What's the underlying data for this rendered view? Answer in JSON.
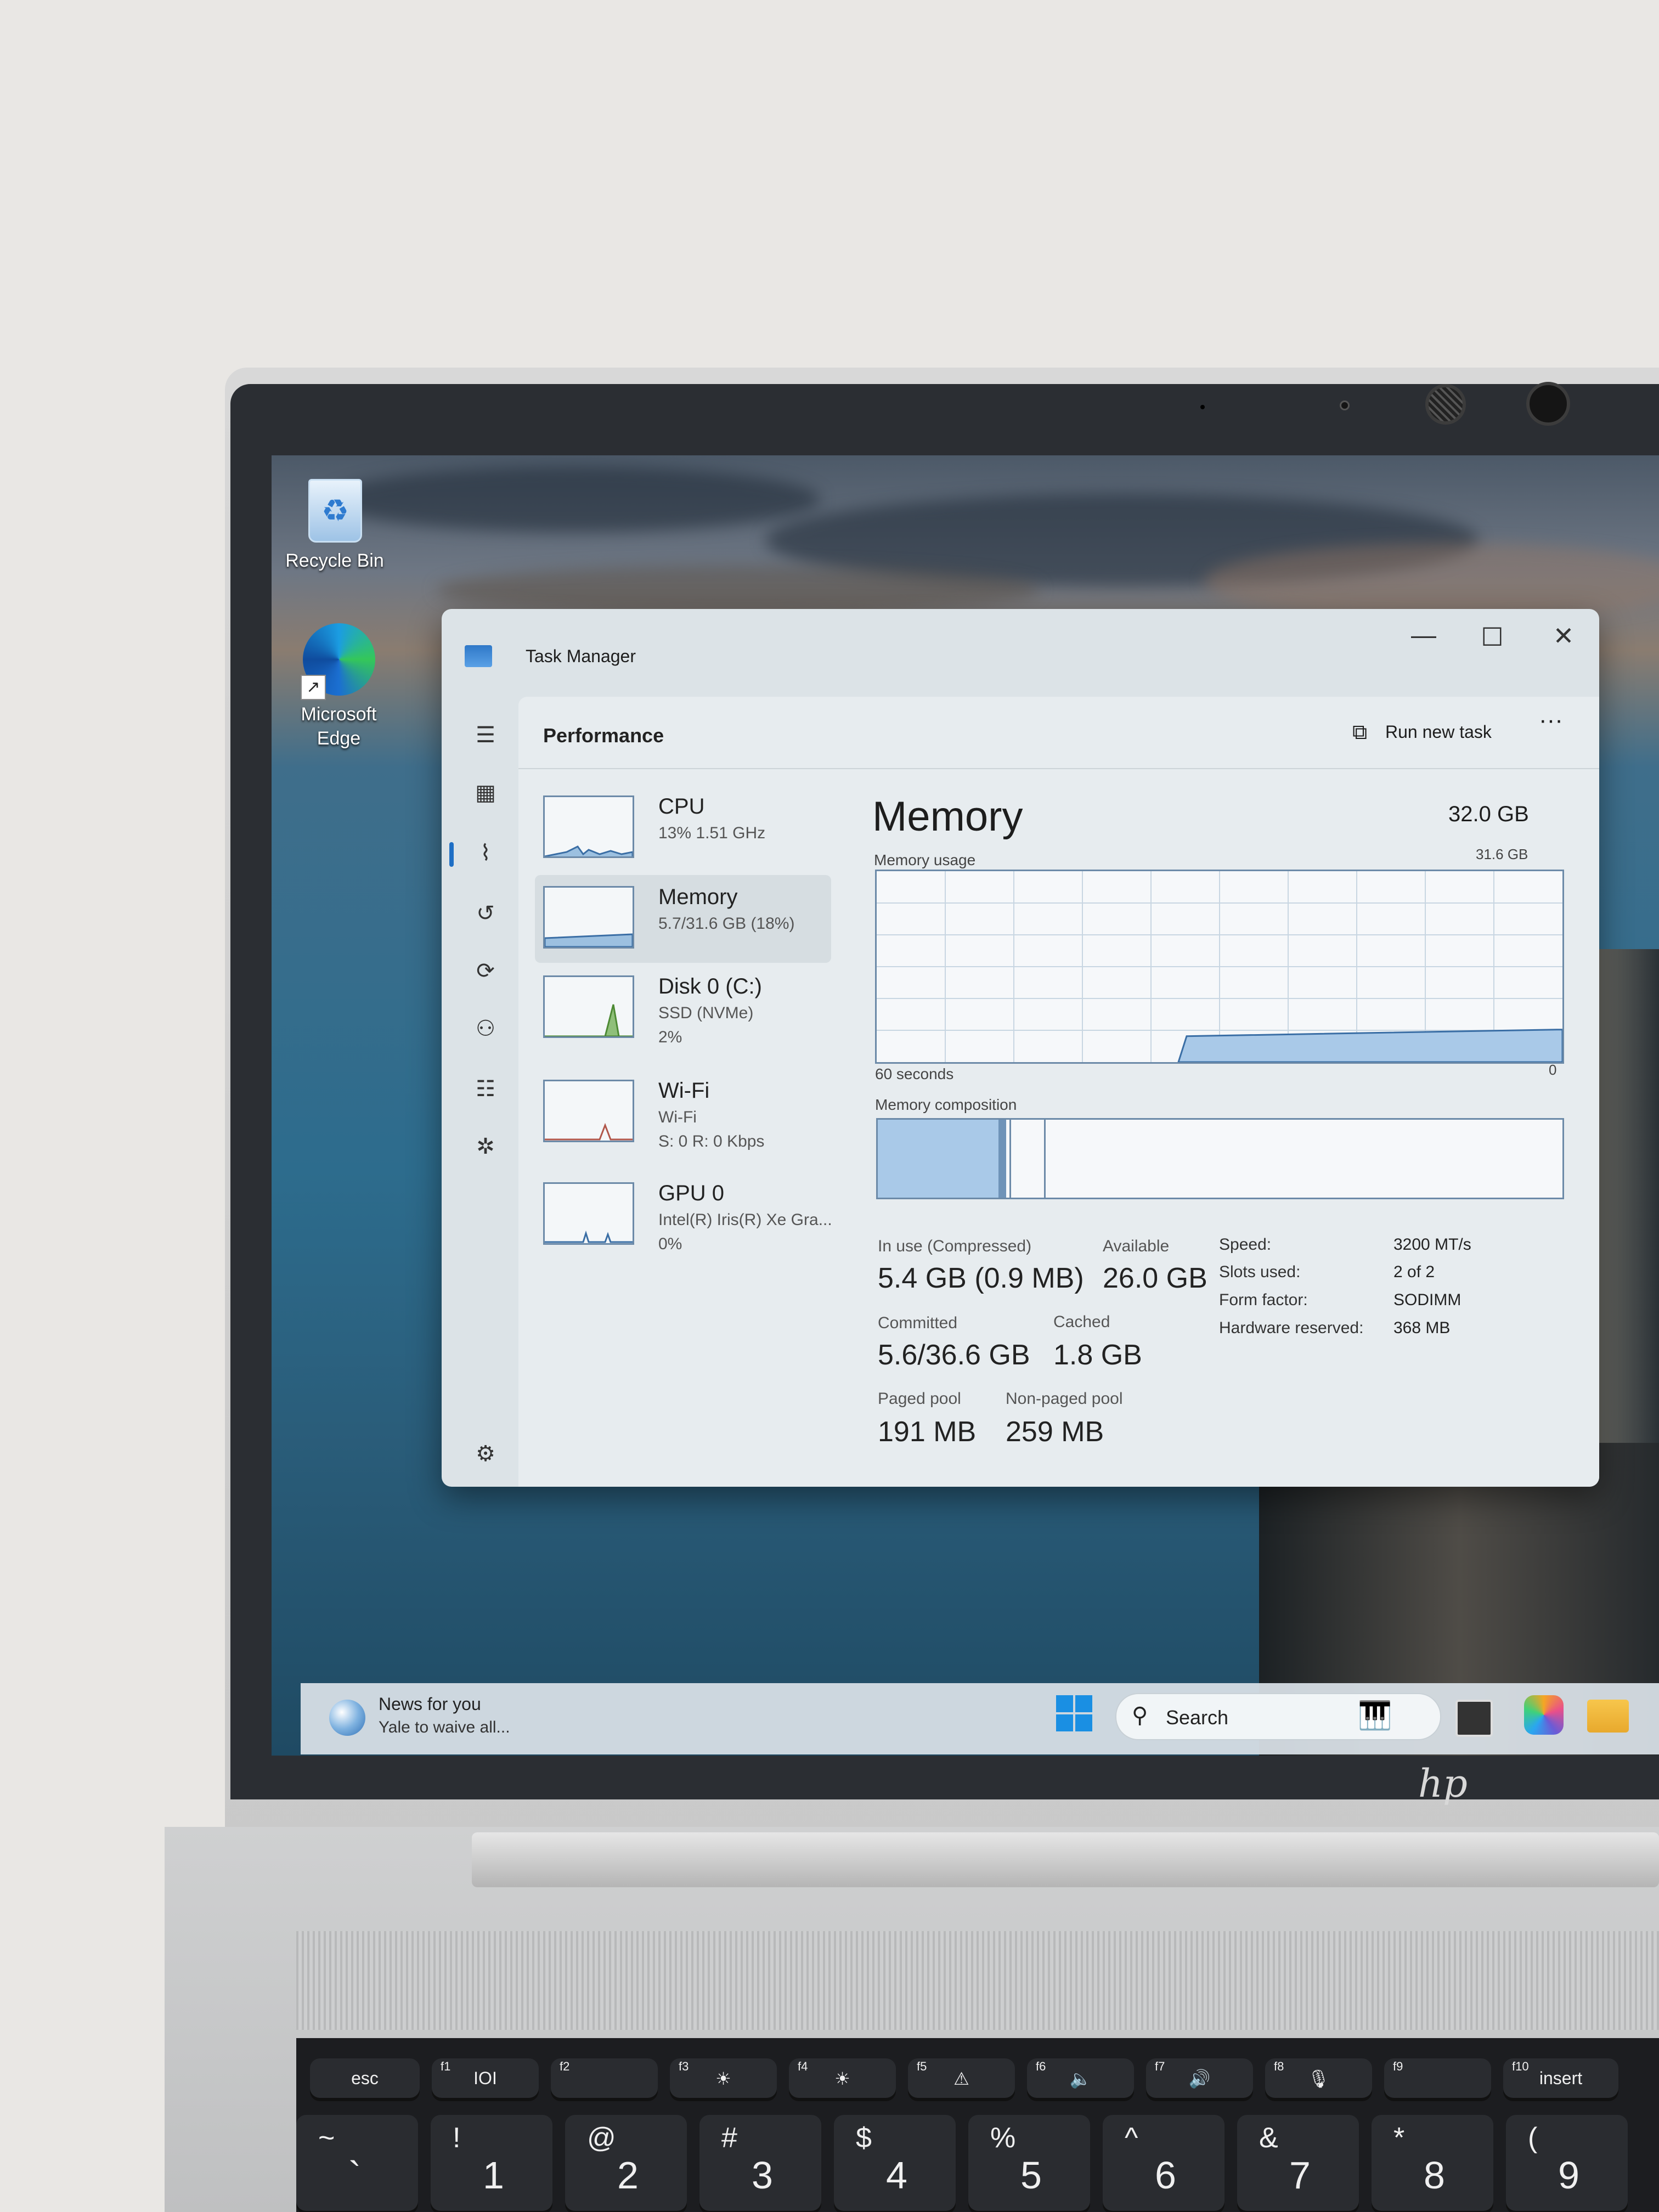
{
  "desktop": {
    "icons": [
      {
        "label": "Recycle Bin"
      },
      {
        "label": "Microsoft Edge"
      }
    ]
  },
  "task_manager": {
    "window_title": "Task Manager",
    "section_title": "Performance",
    "run_new_task": "Run new task",
    "more": "···",
    "sidebar": [
      {
        "title": "CPU",
        "lines": [
          "13% 1.51 GHz"
        ]
      },
      {
        "title": "Memory",
        "lines": [
          "5.7/31.6 GB (18%)"
        ]
      },
      {
        "title": "Disk 0 (C:)",
        "lines": [
          "SSD (NVMe)",
          "2%"
        ]
      },
      {
        "title": "Wi-Fi",
        "lines": [
          "Wi-Fi",
          "S: 0 R: 0 Kbps"
        ]
      },
      {
        "title": "GPU 0",
        "lines": [
          "Intel(R) Iris(R) Xe Gra...",
          "0%"
        ]
      }
    ],
    "memory": {
      "heading": "Memory",
      "total": "32.0 GB",
      "usage_label": "Memory usage",
      "usage_max": "31.6 GB",
      "time_span": "60 seconds",
      "time_zero": "0",
      "composition_label": "Memory composition",
      "usage_fraction": 0.18,
      "stats": {
        "in_use_label": "In use (Compressed)",
        "in_use_value": "5.4 GB (0.9 MB)",
        "available_label": "Available",
        "available_value": "26.0 GB",
        "committed_label": "Committed",
        "committed_value": "5.6/36.6 GB",
        "cached_label": "Cached",
        "cached_value": "1.8 GB",
        "paged_label": "Paged pool",
        "paged_value": "191 MB",
        "nonpaged_label": "Non-paged pool",
        "nonpaged_value": "259 MB"
      },
      "properties": [
        {
          "label": "Speed:",
          "value": "3200 MT/s"
        },
        {
          "label": "Slots used:",
          "value": "2 of 2"
        },
        {
          "label": "Form factor:",
          "value": "SODIMM"
        },
        {
          "label": "Hardware reserved:",
          "value": "368 MB"
        }
      ]
    }
  },
  "taskbar": {
    "news_title": "News for you",
    "news_sub": "Yale to waive all...",
    "search": "Search"
  },
  "laptop": {
    "brand": "hp",
    "function_keys": [
      {
        "corner": "",
        "label": "esc"
      },
      {
        "corner": "f1",
        "label": "IOI"
      },
      {
        "corner": "f2",
        "label": ""
      },
      {
        "corner": "f3",
        "label": "☀"
      },
      {
        "corner": "f4",
        "label": "☀"
      },
      {
        "corner": "f5",
        "label": "⚠"
      },
      {
        "corner": "f6",
        "label": "🔈"
      },
      {
        "corner": "f7",
        "label": "🔊"
      },
      {
        "corner": "f8",
        "label": "🎙"
      },
      {
        "corner": "f9",
        "label": ""
      },
      {
        "corner": "f10",
        "label": "insert"
      }
    ],
    "number_keys": [
      {
        "top": "~",
        "label": "`"
      },
      {
        "top": "!",
        "label": "1"
      },
      {
        "top": "@",
        "label": "2"
      },
      {
        "top": "#",
        "label": "3"
      },
      {
        "top": "$",
        "label": "4"
      },
      {
        "top": "%",
        "label": "5"
      },
      {
        "top": "^",
        "label": "6"
      },
      {
        "top": "&",
        "label": "7"
      },
      {
        "top": "*",
        "label": "8"
      },
      {
        "top": "(",
        "label": "9"
      }
    ]
  }
}
